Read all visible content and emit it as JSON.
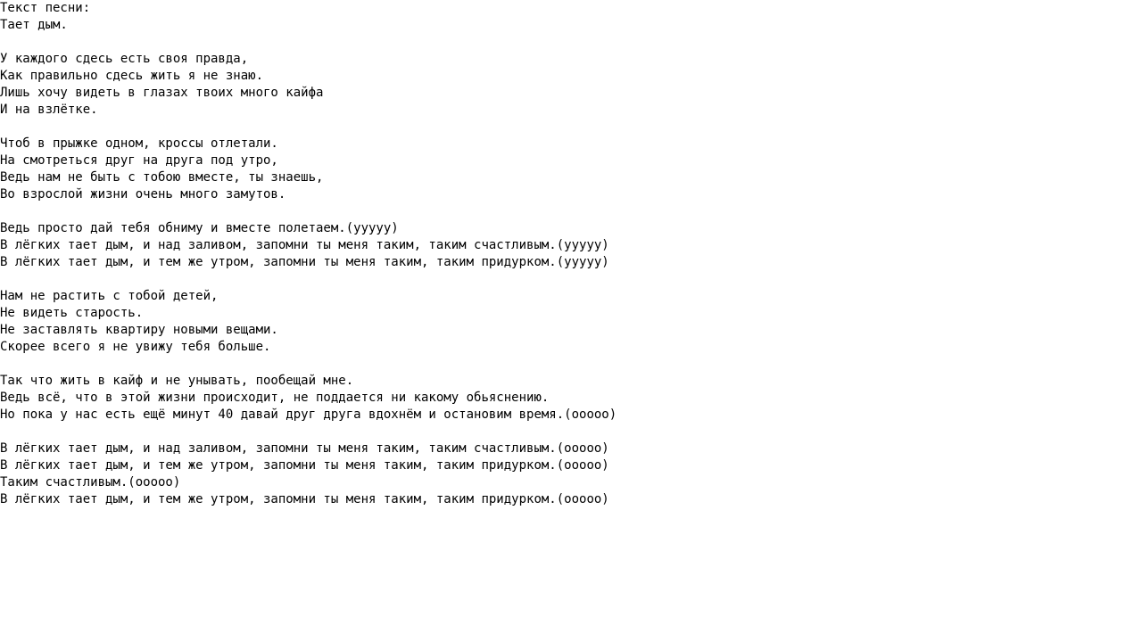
{
  "header": "Текст песни:",
  "title": "Тает дым.",
  "stanzas": [
    [
      "У каждого сдесь есть своя правда,",
      "Как правильно сдесь жить я не знаю.",
      "Лишь хочу видеть в глазах твоих много кайфа",
      "И на взлётке."
    ],
    [
      "Чтоб в прыжке одном, кроссы отлетали.",
      "На смотреться друг на друга под утро,",
      "Ведь нам не быть с тобою вместе, ты знаешь,",
      "Во взрослой жизни очень много замутов."
    ],
    [
      "Ведь просто дай тебя обниму и вместе полетаем.(ууууу)",
      "В лёгких тает дым, и над заливом, запомни ты меня таким, таким счастливым.(ууууу)",
      "В лёгких тает дым, и тем же утром, запомни ты меня таким, таким придурком.(ууууу)"
    ],
    [
      "Нам не растить с тобой детей,",
      "Не видеть старость.",
      "Не заставлять квартиру новыми вещами.",
      "Скорее всего я не увижу тебя больше."
    ],
    [
      "Так что жить в кайф и не унывать, пообещай мне.",
      "Ведь всё, что в этой жизни происходит, не поддается ни какому обьяснению.",
      "Но пока у нас есть ещё минут 40 давай друг друга вдохнём и остановим время.(ооооо)"
    ],
    [
      "В лёгких тает дым, и над заливом, запомни ты меня таким, таким счастливым.(ооооо)",
      "В лёгких тает дым, и тем же утром, запомни ты меня таким, таким придурком.(ооооо)",
      "Таким счастливым.(ооооо)",
      "В лёгких тает дым, и тем же утром, запомни ты меня таким, таким придурком.(ооооо)"
    ]
  ]
}
